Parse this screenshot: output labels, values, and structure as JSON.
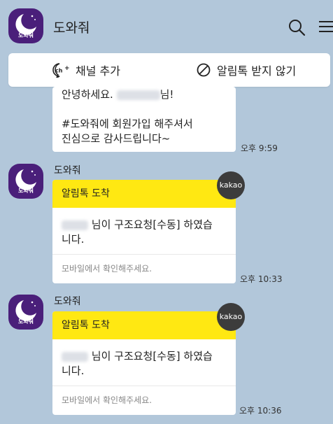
{
  "header": {
    "title": "도와줘",
    "avatar_text": "도와줘"
  },
  "actions": {
    "add_channel": "채널 추가",
    "block_alimtalk": "알림톡 받지 않기"
  },
  "message1": {
    "greeting_prefix": "안녕하세요.",
    "greeting_suffix": "님!",
    "body_line1": "#도와줘에 회원가입 해주셔서",
    "body_line2": "진심으로 감사드립니다~",
    "time": "오후 9:59"
  },
  "message2": {
    "sender": "도와줘",
    "header": "알림톡 도착",
    "body_line1": "님이 구조요청[수동] 하였습",
    "body_line2": "니다.",
    "footer": "모바일에서 확인해주세요.",
    "badge": "kakao",
    "time": "오후 10:33"
  },
  "message3": {
    "sender": "도와줘",
    "header": "알림톡 도착",
    "body_line1": "님이 구조요청[수동] 하였습",
    "body_line2": "니다.",
    "footer": "모바일에서 확인해주세요.",
    "badge": "kakao",
    "time": "오후 10:36"
  },
  "icons": {
    "search": "search-icon",
    "menu": "menu-icon",
    "channel": "channel-add-icon",
    "block": "block-icon"
  },
  "colors": {
    "background": "#b2c7da",
    "brand": "#4a1f7a",
    "alim_header": "#ffe812",
    "badge": "#3c3c3c"
  }
}
